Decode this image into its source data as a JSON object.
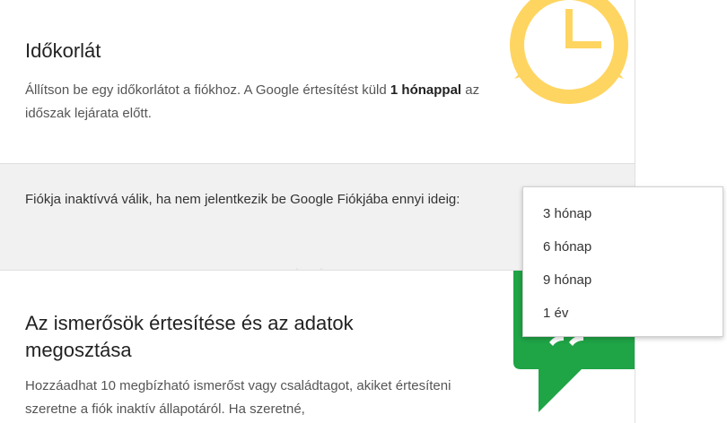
{
  "time_limit": {
    "title": "Időkorlát",
    "desc_part1": "Állítson be egy időkorlátot a fiókhoz. A Google értesítést küld ",
    "desc_bold": "1 hónappal",
    "desc_part2": " az időszak lejárata előtt."
  },
  "inactivity": {
    "text": "Fiókja inaktívvá válik, ha nem jelentkezik be Google Fiókjába ennyi ideig:"
  },
  "dropdown": {
    "options": [
      "3 hónap",
      "6 hónap",
      "9 hónap",
      "1 év"
    ]
  },
  "notify": {
    "title": "Az ismerősök értesítése és az adatok megosztása",
    "desc": "Hozzáadhat 10 megbízható ismerőst vagy családtagot, akiket értesíteni szeretne a fiók inaktív állapotáról. Ha szeretné,"
  },
  "colors": {
    "clock_yellow": "#ffd561",
    "chat_green": "#1fa446",
    "panel_grey": "#f1f1f1"
  },
  "icons": {
    "clock": "clock-icon",
    "chat": "chat-bubble-icon"
  }
}
